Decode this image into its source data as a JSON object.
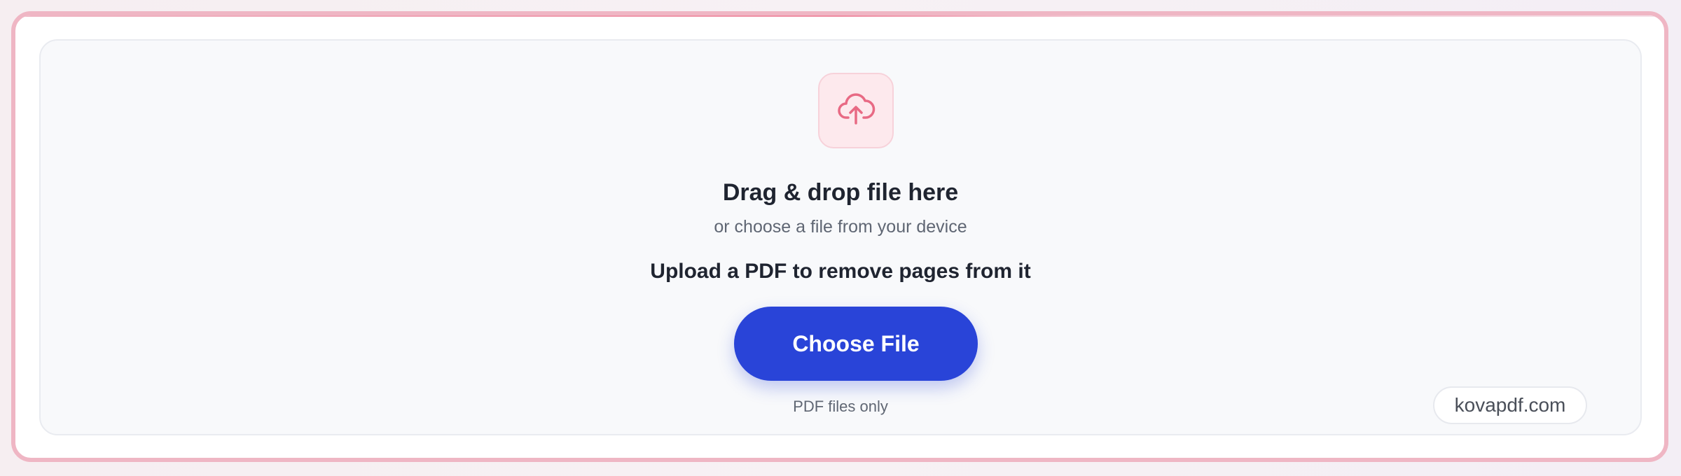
{
  "colors": {
    "accent_blue": "#2944d8",
    "accent_pink": "#ef8aa0",
    "frame_pink": "#efb6c4",
    "surface": "#f8f9fb",
    "text_primary": "#1f2430",
    "text_secondary": "#5f6673"
  },
  "dropzone": {
    "icon": "cloud-upload-icon",
    "headline": "Drag & drop file here",
    "subtext": "or choose a file from your device",
    "instruction": "Upload a PDF to remove pages from it",
    "button_label": "Choose File",
    "file_note": "PDF files only"
  },
  "brand": {
    "label": "kovapdf.com"
  }
}
